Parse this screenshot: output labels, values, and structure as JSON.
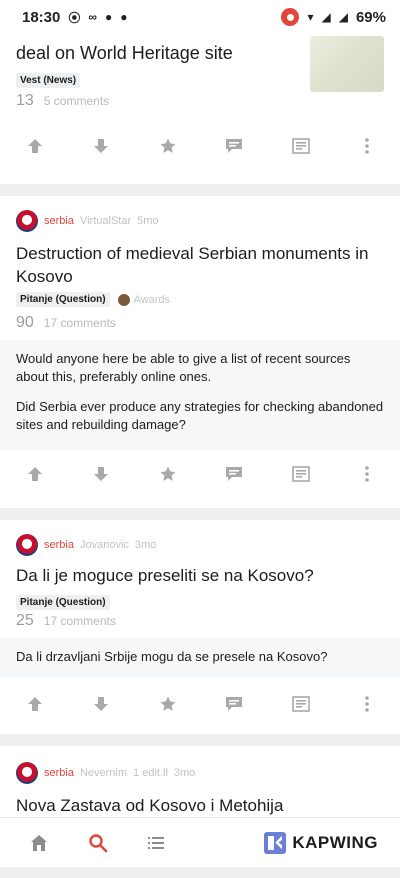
{
  "status_bar": {
    "time": "18:30",
    "left_icons": [
      "record-circle-icon",
      "infinity-icon",
      "water-drop-icon",
      "water-drop-icon"
    ],
    "battery": "69%",
    "right_icons": [
      "screen-record-icon",
      "wifi-icon",
      "signal-icon",
      "signal-icon"
    ]
  },
  "partial_post": {
    "title": "deal on World Heritage site",
    "flair": "Vest (News)",
    "score": "13",
    "comments": "5 comments"
  },
  "posts": [
    {
      "subreddit": "serbia",
      "user": "VirtualStar",
      "time": "5mo",
      "title": "Destruction of medieval Serbian monuments in Kosovo",
      "flair": "Pitanje (Question)",
      "awards": "Awards",
      "score": "90",
      "comments": "17 comments",
      "body_p1": "Would anyone here be able to give a list of recent sources about this, preferably online ones.",
      "body_p2": "Did Serbia ever produce any strategies for checking abandoned sites and rebuilding damage?"
    },
    {
      "subreddit": "serbia",
      "user": "Jovanovic",
      "time": "3mo",
      "title": "Da li je moguce preseliti se na Kosovo?",
      "flair": "Pitanje (Question)",
      "score": "25",
      "comments": "17 comments",
      "body_p1": "Da li drzavljani Srbije mogu da se presele na Kosovo?"
    },
    {
      "subreddit": "serbia",
      "user": "Nevernim",
      "edited": "1 edit.ll",
      "time": "3mo",
      "title": "Nova Zastava od Kosovo i Metohija"
    }
  ],
  "bottom_nav": {
    "items": [
      "home-icon",
      "search-icon",
      "list-icon"
    ],
    "brand": "KAPWING"
  },
  "colors": {
    "accent": "#e0463b",
    "brand": "#6b7fd7"
  }
}
